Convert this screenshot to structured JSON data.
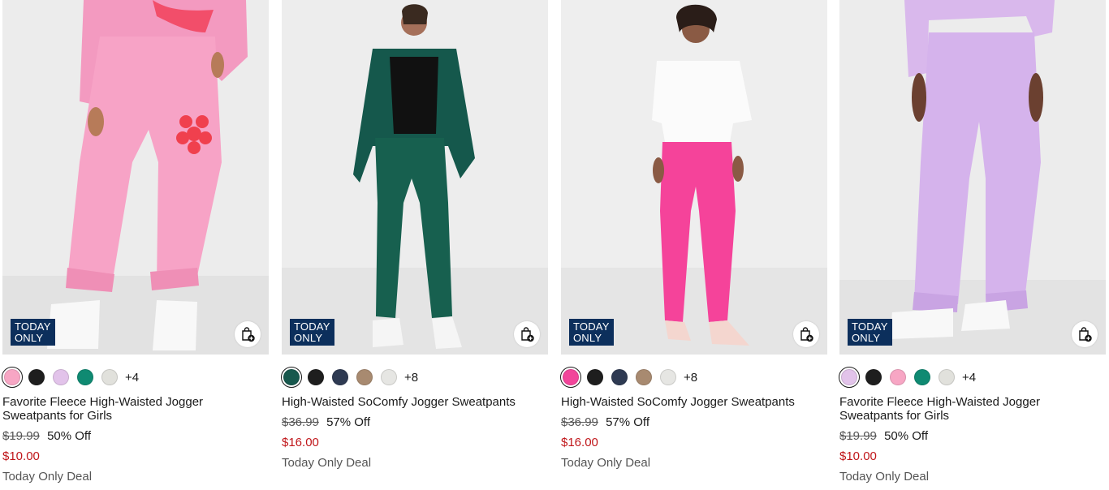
{
  "products": [
    {
      "badge": "TODAY\nONLY",
      "bag_icon": "shopping-bag-plus-icon",
      "swatches": [
        "#f7a6c4",
        "#1e1e1e",
        "#e2c3ea",
        "#0f8a72",
        "#e1e1dc"
      ],
      "more_colors": "+4",
      "title": "Favorite Fleece High-Waisted Jogger Sweatpants for Girls",
      "original_price": "$19.99",
      "discount": "50% Off",
      "sale_price": "$10.00",
      "deal": "Today Only Deal"
    },
    {
      "badge": "TODAY\nONLY",
      "bag_icon": "shopping-bag-plus-icon",
      "swatches": [
        "#17584d",
        "#1e1e1e",
        "#2e3a52",
        "#a88a70",
        "#e6e6e3"
      ],
      "more_colors": "+8",
      "title": "High-Waisted SoComfy Jogger Sweatpants",
      "original_price": "$36.99",
      "discount": "57% Off",
      "sale_price": "$16.00",
      "deal": "Today Only Deal"
    },
    {
      "badge": "TODAY\nONLY",
      "bag_icon": "shopping-bag-plus-icon",
      "swatches": [
        "#f2449a",
        "#1e1e1e",
        "#2e3a52",
        "#a88a70",
        "#e6e6e3"
      ],
      "more_colors": "+8",
      "title": "High-Waisted SoComfy Jogger Sweatpants",
      "original_price": "$36.99",
      "discount": "57% Off",
      "sale_price": "$16.00",
      "deal": "Today Only Deal"
    },
    {
      "badge": "TODAY\nONLY",
      "bag_icon": "shopping-bag-plus-icon",
      "swatches": [
        "#e2c3ea",
        "#1e1e1e",
        "#f7a6c4",
        "#0f8a72",
        "#e1e1dc"
      ],
      "more_colors": "+4",
      "title": "Favorite Fleece High-Waisted Jogger Sweatpants for Girls",
      "original_price": "$19.99",
      "discount": "50% Off",
      "sale_price": "$10.00",
      "deal": "Today Only Deal"
    }
  ],
  "colors": {
    "badge_bg": "#0c2f5c",
    "sale_red": "#c0161a"
  }
}
